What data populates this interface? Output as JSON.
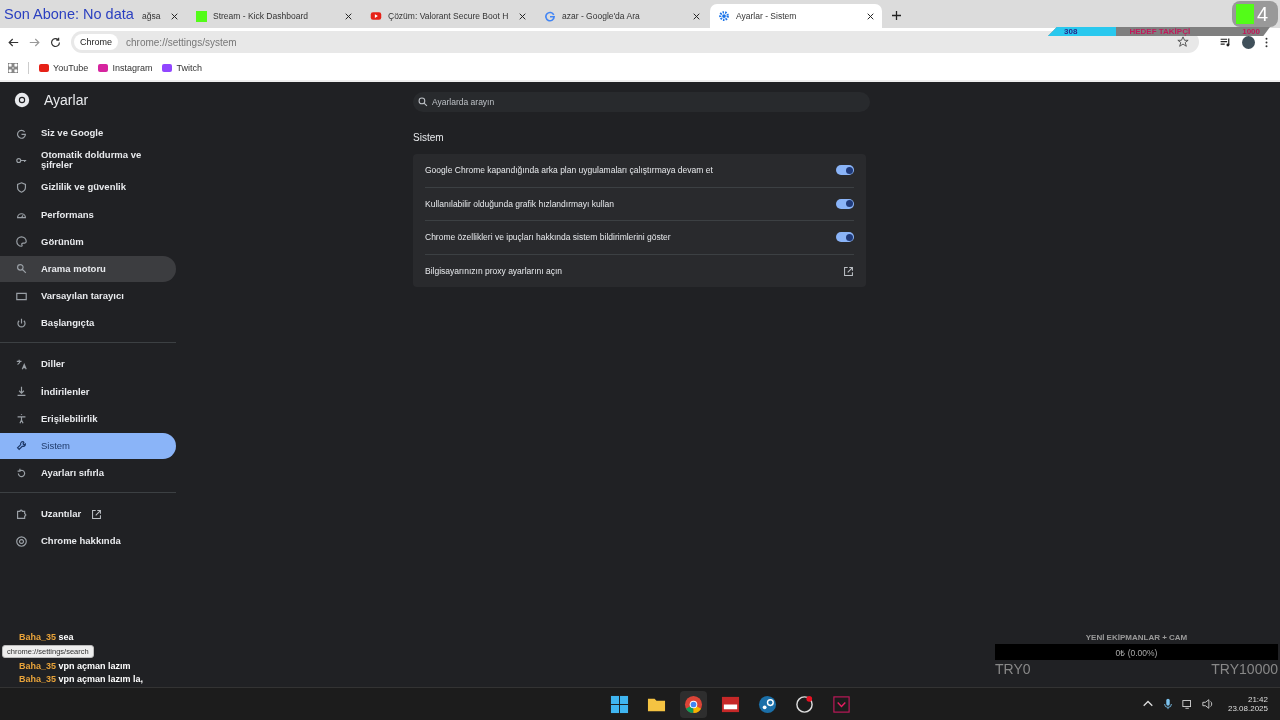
{
  "tabs": [
    {
      "title": "ağsa",
      "selected": false
    },
    {
      "title": "Stream - Kick Dashboard",
      "selected": false
    },
    {
      "title": "Çözüm: Valorant Secure Boot H",
      "selected": false
    },
    {
      "title": "azar - Google'da Ara",
      "selected": false
    },
    {
      "title": "Ayarlar - Sistem",
      "selected": true
    }
  ],
  "stream_overlay": {
    "last_subscriber": "Son Abone: No data",
    "follower_goal": {
      "current": "308",
      "label": "HEDEF TAKİPÇİ",
      "target": "1000",
      "level": 0.308
    },
    "viewer_count": "4"
  },
  "address_bar": {
    "chip": "Chrome",
    "url": "chrome://settings/system"
  },
  "bookmarks": [
    "YouTube",
    "Instagram",
    "Twitch"
  ],
  "settings": {
    "title": "Ayarlar",
    "search": {
      "placeholder": "Ayarlarda arayın"
    },
    "sidebar": {
      "groups": [
        [
          {
            "label": "Siz ve Google",
            "selected": false,
            "hovered": false
          },
          {
            "label": "Otomatik doldurma ve şifreler",
            "selected": false,
            "hovered": false
          },
          {
            "label": "Gizlilik ve güvenlik",
            "selected": false,
            "hovered": false
          },
          {
            "label": "Performans",
            "selected": false,
            "hovered": false
          },
          {
            "label": "Görünüm",
            "selected": false,
            "hovered": false
          },
          {
            "label": "Arama motoru",
            "selected": false,
            "hovered": true
          },
          {
            "label": "Varsayılan tarayıcı",
            "selected": false,
            "hovered": false
          },
          {
            "label": "Başlangıçta",
            "selected": false,
            "hovered": false
          }
        ],
        [
          {
            "label": "Diller",
            "selected": false,
            "hovered": false
          },
          {
            "label": "İndirilenler",
            "selected": false,
            "hovered": false
          },
          {
            "label": "Erişilebilirlik",
            "selected": false,
            "hovered": false
          },
          {
            "label": "Sistem",
            "selected": true,
            "hovered": false
          },
          {
            "label": "Ayarları sıfırla",
            "selected": false,
            "hovered": false
          }
        ],
        [
          {
            "label": "Uzantılar",
            "selected": false,
            "hovered": false,
            "external": true
          },
          {
            "label": "Chrome hakkında",
            "selected": false,
            "hovered": false,
            "external": false
          }
        ]
      ]
    },
    "section_title": "Sistem",
    "rows": [
      {
        "kind": "toggle",
        "label": "Google Chrome kapandığında arka plan uygulamaları çalıştırmaya devam et",
        "on": true
      },
      {
        "kind": "toggle",
        "label": "Kullanılabilir olduğunda grafik hızlandırmayı kullan",
        "on": true
      },
      {
        "kind": "toggle",
        "label": "Chrome özellikleri ve ipuçları hakkında sistem bildirimlerini göster",
        "on": true
      },
      {
        "kind": "link",
        "label": "Bilgisayarınızın proxy ayarlarını açın"
      }
    ]
  },
  "status_tooltip": "chrome://settings/search",
  "chat": [
    {
      "user": "Baha_35",
      "text": "sea"
    },
    {
      "user": "Baha_35",
      "text": "vpn açman lazım"
    },
    {
      "user": "Baha_35",
      "text": "vpn açman lazım la,"
    }
  ],
  "donation_goal": {
    "title": "YENİ EKİPMANLAR + CAM",
    "amount": "0₺ (0.00%)",
    "level": 0,
    "min": "TRY0",
    "max": "TRY10000"
  },
  "taskbar": {
    "time": "21:42",
    "date": "23.08.2025"
  }
}
